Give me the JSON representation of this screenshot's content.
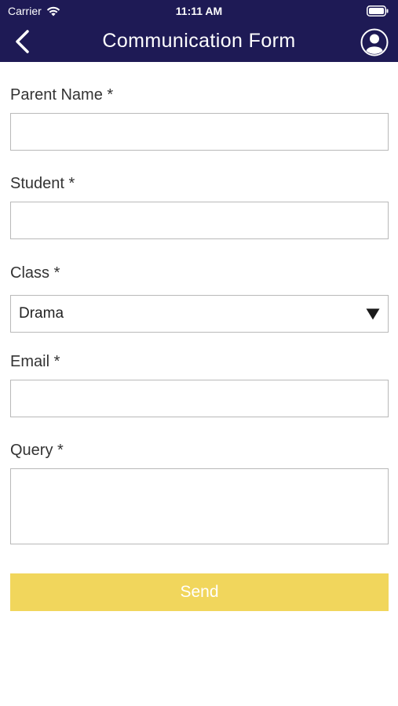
{
  "status_bar": {
    "carrier": "Carrier",
    "time": "11:11 AM"
  },
  "nav": {
    "title": "Communication Form",
    "back_icon": "chevron-left-icon",
    "profile_icon": "user-circle-icon"
  },
  "form": {
    "parent_name": {
      "label": "Parent Name *",
      "value": ""
    },
    "student": {
      "label": "Student *",
      "value": ""
    },
    "class": {
      "label": "Class *",
      "selected": "Drama"
    },
    "email": {
      "label": "Email *",
      "value": ""
    },
    "query": {
      "label": "Query *",
      "value": ""
    },
    "send_label": "Send"
  },
  "colors": {
    "header_bg": "#1e1a55",
    "send_bg": "#f1d65c"
  }
}
